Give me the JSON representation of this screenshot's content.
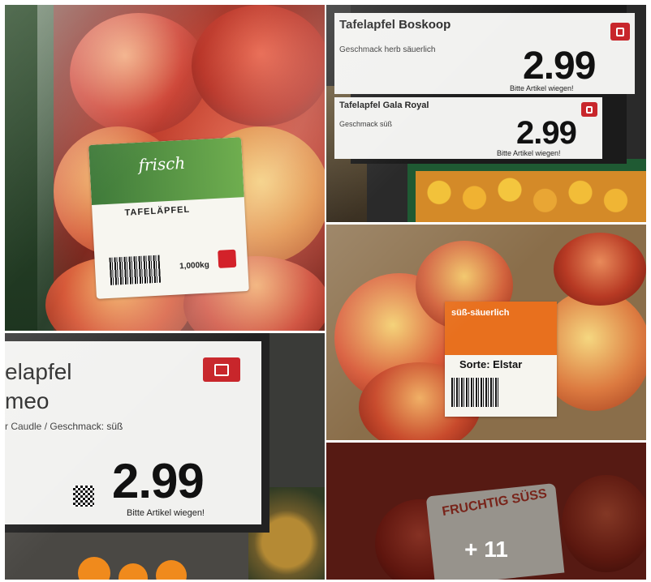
{
  "collage": {
    "tile1": {
      "label_script": "frisch",
      "label_title": "TAFELÄPFEL",
      "label_weight": "1,000kg"
    },
    "tile2": {
      "tag1_name": "Tafelapfel Boskoop",
      "tag1_sub": "Geschmack herb säuerlich",
      "tag1_price": "2.99",
      "tag1_hint": "Bitte Artikel wiegen!",
      "tag2_name": "Tafelapfel Gala Royal",
      "tag2_sub": "Geschmack süß",
      "tag2_price": "2.99",
      "tag2_hint": "Bitte Artikel wiegen!"
    },
    "tile3": {
      "tag_name_line1": "elapfel",
      "tag_name_line2": "meo",
      "tag_sub": "r Caudle / Geschmack: süß",
      "tag_price": "2.99",
      "tag_hint": "Bitte Artikel wiegen!"
    },
    "tile4": {
      "label_top": "süß-säuerlich",
      "label_sort": "Sorte: Elstar"
    },
    "tile5": {
      "label_text": "FRUCHTIG SÜSS",
      "more_count": "+ 11"
    }
  },
  "colors": {
    "kaufland_red": "#d3222a",
    "tag_bg": "#f1f1ef",
    "frame": "#1b1b1b"
  }
}
